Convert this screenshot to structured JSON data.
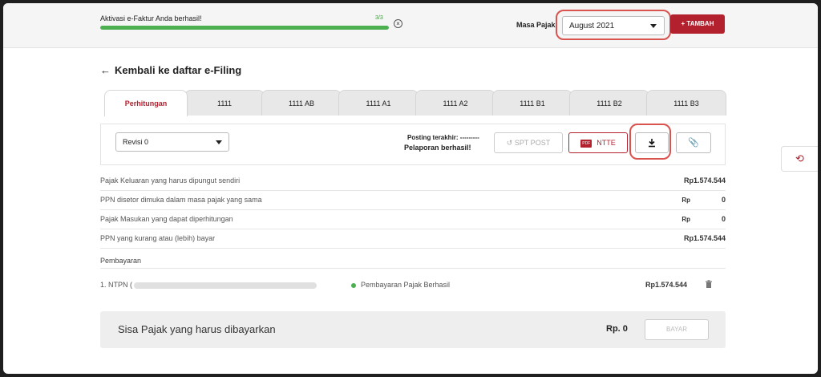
{
  "notification": {
    "message": "Aktivasi e-Faktur Anda berhasil!",
    "count": "3/3",
    "progress": 1.0,
    "close_icon": "circle-x-icon"
  },
  "header": {
    "masa_pajak_label": "Masa Pajak",
    "masa_pajak_value": "August  2021",
    "add_button_label": "+ TAMBAH"
  },
  "back": {
    "label": "Kembali ke daftar e-Filing",
    "icon": "arrow-left-icon"
  },
  "tabs": [
    {
      "label": "Perhitungan",
      "active": true
    },
    {
      "label": "1111"
    },
    {
      "label": "1111 AB"
    },
    {
      "label": "1111 A1"
    },
    {
      "label": "1111 A2"
    },
    {
      "label": "1111 B1"
    },
    {
      "label": "1111 B2"
    },
    {
      "label": "1111 B3"
    }
  ],
  "toolbar": {
    "revisi_value": "Revisi 0",
    "posting_label": "Posting terakhir: ---------",
    "posting_status": "Pelaporan berhasil!",
    "spt_post_label": "SPT POST",
    "ntte_label": "NTTE",
    "pdf_badge": "PDF",
    "download_icon": "download-icon",
    "attach_icon": "paperclip-icon"
  },
  "summary": [
    {
      "label": "Pajak Keluaran yang harus dipungut sendiri",
      "prefix": "",
      "value": "Rp1.574.544"
    },
    {
      "label": "PPN disetor dimuka dalam masa pajak yang sama",
      "prefix": "Rp",
      "value": "0"
    },
    {
      "label": "Pajak Masukan yang dapat diperhitungan",
      "prefix": "Rp",
      "value": "0"
    },
    {
      "label": "PPN yang kurang atau (lebih) bayar",
      "prefix": "",
      "value": "Rp1.574.544"
    }
  ],
  "pembayaran": {
    "title": "Pembayaran",
    "items": [
      {
        "ntpn_label": "1. NTPN (",
        "status": "Pembayaran Pajak Berhasil",
        "amount": "Rp1.574.544"
      }
    ]
  },
  "sisa": {
    "label": "Sisa Pajak yang harus dibayarkan",
    "value": "Rp. 0",
    "bayar_label": "BAYAR"
  },
  "history_icon": "history-icon",
  "colors": {
    "brand": "#b3212e",
    "success": "#4caf50",
    "highlight": "#d9534f"
  }
}
